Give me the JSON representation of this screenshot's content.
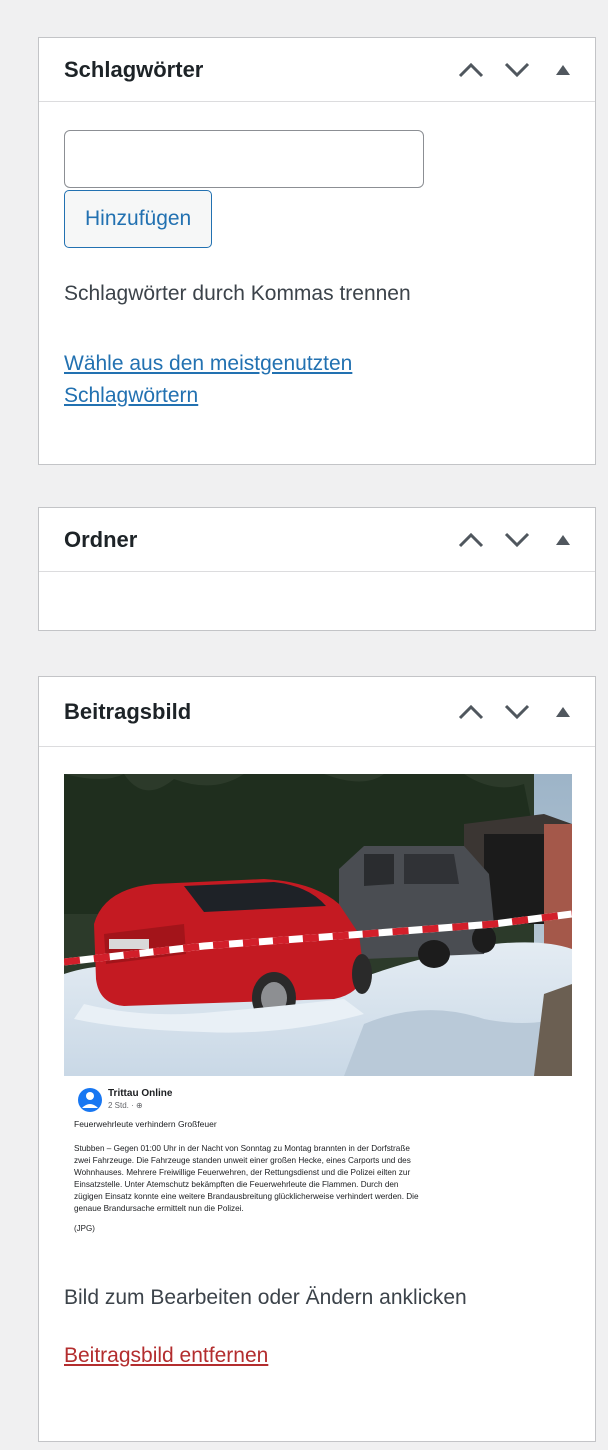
{
  "tags_box": {
    "title": "Schlagwörter",
    "input_value": "",
    "add_button": "Hinzufügen",
    "hint": "Schlagwörter durch Kommas trennen",
    "choose_link_line1": "Wähle aus den meistgenutzten",
    "choose_link_line2": "Schlagwörtern"
  },
  "folder_box": {
    "title": "Ordner"
  },
  "featured_box": {
    "title": "Beitragsbild",
    "image": {
      "post_author": "Trittau Online",
      "post_meta": "2 Std. · ⊕",
      "post_title": "Feuerwehrleute verhindern Großfeuer",
      "post_body": [
        "Stubben – Gegen 01:00 Uhr in der Nacht von Sonntag zu Montag brannten in der Dorfstraße",
        "zwei Fahrzeuge. Die Fahrzeuge standen unweit einer großen Hecke, eines Carports und des",
        "Wohnhauses. Mehrere Freiwillige Feuerwehren, der Rettungsdienst und die Polizei eilten zur",
        "Einsatzstelle. Unter Atemschutz bekämpften die Feuerwehrleute die Flammen. Durch den",
        "zügigen Einsatz konnte eine weitere Brandausbreitung glücklicherweise verhindert werden. Die",
        "genaue Brandursache ermittelt nun die Polizei."
      ],
      "post_footer": "(JPG)"
    },
    "edit_hint": "Bild zum Bearbeiten oder Ändern anklicken",
    "remove_link": "Beitragsbild entfernen"
  },
  "colors": {
    "link": "#2271b1",
    "remove": "#b32d2e",
    "border": "#c3c4c7",
    "background": "#f0f0f1"
  },
  "icons": [
    "chevron-up-icon",
    "chevron-down-icon",
    "triangle-up-icon"
  ]
}
